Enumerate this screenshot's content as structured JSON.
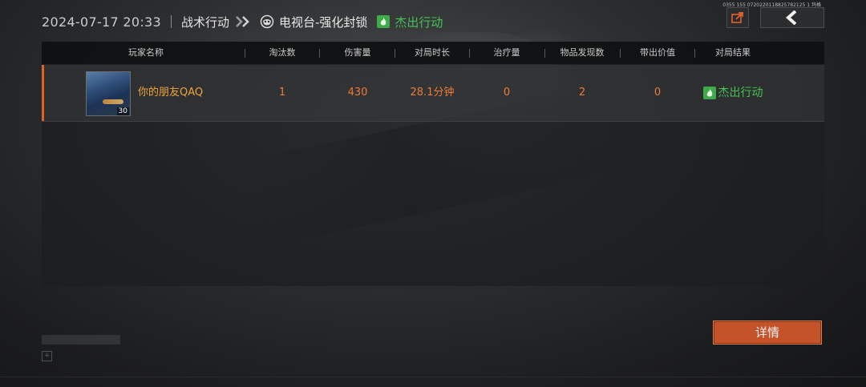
{
  "header": {
    "datetime": "2024-07-17 20:33",
    "mode": "战术行动",
    "map": "电视台-强化封锁",
    "result": "杰出行动"
  },
  "top_right": {
    "info": "0355 155  0720220118825782125 1 玛格"
  },
  "table": {
    "columns": [
      "玩家名称",
      "淘汰数",
      "伤害量",
      "对局时长",
      "治疗量",
      "物品发现数",
      "带出价值",
      "对局结果"
    ],
    "rows": [
      {
        "player_name": "你的朋友QAQ",
        "level": "30",
        "eliminations": "1",
        "damage": "430",
        "duration": "28.1分钟",
        "healing": "0",
        "items_found": "2",
        "extract_value": "0",
        "result": "杰出行动"
      }
    ]
  },
  "detail_button": {
    "label": "详情"
  },
  "colors": {
    "accent": "#e0622a",
    "value_orange": "#ef7a3a",
    "name_gold": "#f0a33a",
    "success_green": "#46c155"
  }
}
